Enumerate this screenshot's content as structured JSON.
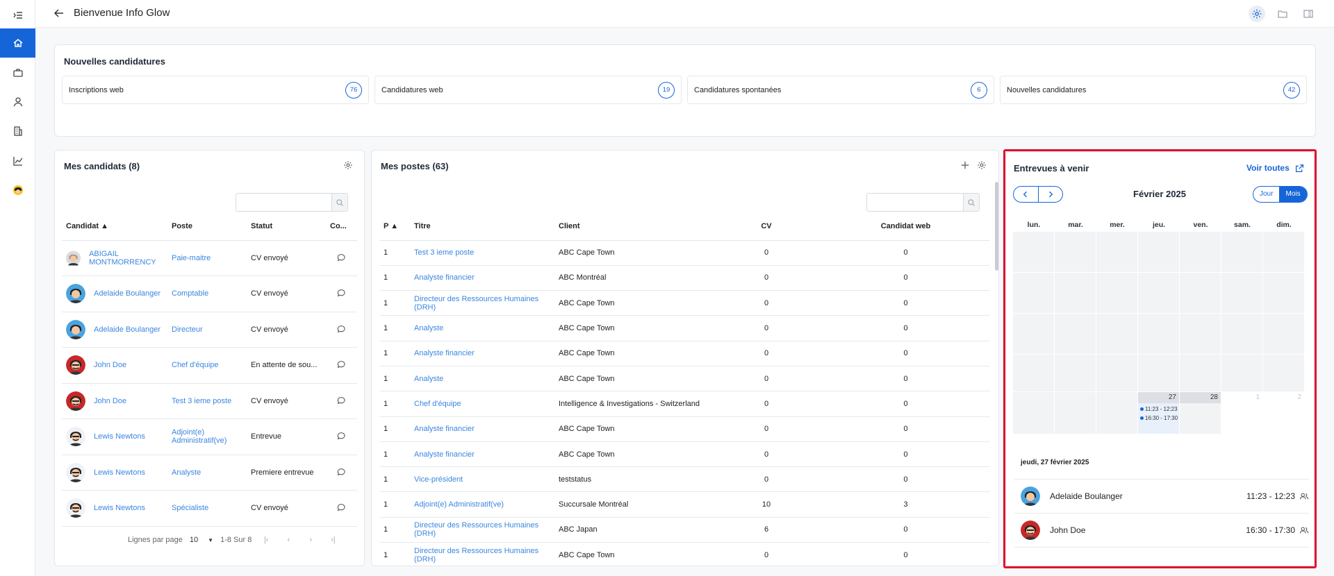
{
  "header": {
    "title": "Bienvenue Info Glow"
  },
  "rail": {
    "items": [
      "menu-icon",
      "home-icon",
      "briefcase-icon",
      "person-icon",
      "building-icon",
      "chart-icon",
      "avatar-icon"
    ]
  },
  "new_apps": {
    "title": "Nouvelles candidatures",
    "tiles": [
      {
        "label": "Inscriptions web",
        "count": "76"
      },
      {
        "label": "Candidatures web",
        "count": "19"
      },
      {
        "label": "Candidatures spontanées",
        "count": "6"
      },
      {
        "label": "Nouvelles candidatures",
        "count": "42"
      }
    ]
  },
  "candidates": {
    "title": "Mes candidats (8)",
    "columns": [
      "Candidat ▲",
      "Poste",
      "Statut",
      "Co..."
    ],
    "rows": [
      {
        "name": "ABIGAIL MONTMORRENCY",
        "poste": "Paie-maitre",
        "statut": "CV envoyé",
        "avatar": "woman"
      },
      {
        "name": "Adelaide Boulanger",
        "poste": "Comptable",
        "statut": "CV envoyé",
        "avatar": "woman2"
      },
      {
        "name": "Adelaide Boulanger",
        "poste": "Directeur",
        "statut": "CV envoyé",
        "avatar": "woman2"
      },
      {
        "name": "John Doe",
        "poste": "Chef d'équipe",
        "statut": "En attente de sou...",
        "avatar": "man"
      },
      {
        "name": "John Doe",
        "poste": "Test 3 ieme poste",
        "statut": "CV envoyé",
        "avatar": "man"
      },
      {
        "name": "Lewis Newtons",
        "poste": "Adjoint(e) Administratif(ve)",
        "statut": "Entrevue",
        "avatar": "man2"
      },
      {
        "name": "Lewis Newtons",
        "poste": "Analyste",
        "statut": "Premiere entrevue",
        "avatar": "man2"
      },
      {
        "name": "Lewis Newtons",
        "poste": "Spécialiste",
        "statut": "CV envoyé",
        "avatar": "man2"
      }
    ],
    "pager": {
      "rows_label": "Lignes par page",
      "rows_value": "10",
      "range": "1-8 Sur 8"
    }
  },
  "postes": {
    "title": "Mes postes (63)",
    "columns": [
      "P ▲",
      "Titre",
      "Client",
      "CV",
      "Candidat web"
    ],
    "rows": [
      {
        "p": "1",
        "titre": "Test 3 ieme poste",
        "client": "ABC Cape Town",
        "cv": "0",
        "web": "0"
      },
      {
        "p": "1",
        "titre": "Analyste financier",
        "client": "ABC Montréal",
        "cv": "0",
        "web": "0"
      },
      {
        "p": "1",
        "titre": "Directeur des Ressources Humaines (DRH)",
        "client": "ABC Cape Town",
        "cv": "0",
        "web": "0"
      },
      {
        "p": "1",
        "titre": "Analyste",
        "client": "ABC Cape Town",
        "cv": "0",
        "web": "0"
      },
      {
        "p": "1",
        "titre": "Analyste financier",
        "client": "ABC Cape Town",
        "cv": "0",
        "web": "0"
      },
      {
        "p": "1",
        "titre": "Analyste",
        "client": "ABC Cape Town",
        "cv": "0",
        "web": "0"
      },
      {
        "p": "1",
        "titre": "Chef d'équipe",
        "client": "Intelligence & Investigations - Switzerland",
        "cv": "0",
        "web": "0"
      },
      {
        "p": "1",
        "titre": "Analyste financier",
        "client": "ABC Cape Town",
        "cv": "0",
        "web": "0"
      },
      {
        "p": "1",
        "titre": "Analyste financier",
        "client": "ABC Cape Town",
        "cv": "0",
        "web": "0"
      },
      {
        "p": "1",
        "titre": "Vice-président",
        "client": "teststatus",
        "cv": "0",
        "web": "0"
      },
      {
        "p": "1",
        "titre": "Adjoint(e) Administratif(ve)",
        "client": "Succursale Montréal",
        "cv": "10",
        "web": "3"
      },
      {
        "p": "1",
        "titre": "Directeur des Ressources Humaines (DRH)",
        "client": "ABC Japan",
        "cv": "6",
        "web": "0"
      },
      {
        "p": "1",
        "titre": "Directeur des Ressources Humaines (DRH)",
        "client": "ABC Cape Town",
        "cv": "0",
        "web": "0"
      }
    ]
  },
  "interviews": {
    "title": "Entrevues à venir",
    "see_all": "Voir toutes",
    "month": "Février 2025",
    "view_day": "Jour",
    "view_month": "Mois",
    "weekdays": [
      "lun.",
      "mar.",
      "mer.",
      "jeu.",
      "ven.",
      "sam.",
      "dim."
    ],
    "last_week_days": [
      "",
      "",
      "",
      "27",
      "28",
      "1",
      "2"
    ],
    "cell_events": [
      "11:23 - 12:23",
      "16:30 - 17:30"
    ],
    "selected_date": "jeudi, 27 février 2025",
    "events": [
      {
        "name": "Adelaide Boulanger",
        "time": "11:23 - 12:23",
        "avatar": "woman2"
      },
      {
        "name": "John Doe",
        "time": "16:30 - 17:30",
        "avatar": "man"
      }
    ]
  },
  "colors": {
    "accent": "#1565d8",
    "link": "#3a86e0",
    "highlight": "#e0102f"
  }
}
